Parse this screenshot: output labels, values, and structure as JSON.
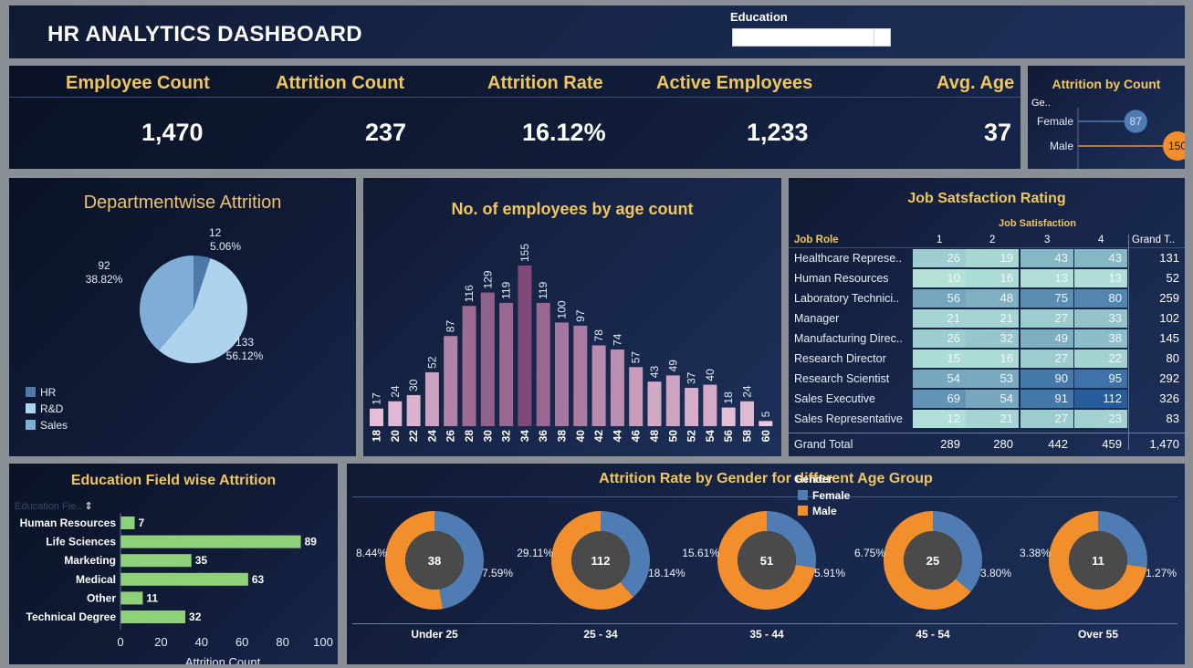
{
  "header": {
    "title": "HR ANALYTICS DASHBOARD",
    "filter_label": "Education",
    "filter_value": ""
  },
  "kpis": [
    {
      "label": "Employee Count",
      "value": "1,470"
    },
    {
      "label": "Attrition Count",
      "value": "237"
    },
    {
      "label": "Attrition Rate",
      "value": "16.12%"
    },
    {
      "label": "Active Employees",
      "value": "1,233"
    },
    {
      "label": "Avg. Age",
      "value": "37"
    }
  ],
  "colors": {
    "gold": "#f0c75e",
    "female": "#4f7db3",
    "male": "#f28e2b",
    "hr": "#4e79a7",
    "rnd": "#aed3ef",
    "sales": "#7eaed8",
    "age_bar_dark": "#7f4a7a",
    "age_bar_light": "#f1cce3",
    "edu_bar": "#8fd07a"
  },
  "chart_data": [
    {
      "id": "attrition_by_count",
      "type": "scatter",
      "title": "Attrition by Count",
      "column_header": "Ge..",
      "categories": [
        "Female",
        "Male"
      ],
      "values": [
        87,
        150
      ]
    },
    {
      "id": "department_attrition",
      "type": "pie",
      "title": "Departmentwise Attrition",
      "categories": [
        "HR",
        "R&D",
        "Sales"
      ],
      "values": [
        12,
        133,
        92
      ],
      "labels": [
        "5.06%",
        "56.12%",
        "38.82%"
      ]
    },
    {
      "id": "age_count",
      "type": "bar",
      "title": "No. of employees by age count",
      "categories": [
        "18",
        "20",
        "22",
        "24",
        "26",
        "28",
        "30",
        "32",
        "34",
        "36",
        "38",
        "40",
        "42",
        "44",
        "46",
        "48",
        "50",
        "52",
        "54",
        "56",
        "58",
        "60"
      ],
      "values": [
        17,
        24,
        30,
        52,
        87,
        116,
        129,
        119,
        155,
        119,
        100,
        97,
        78,
        74,
        57,
        43,
        49,
        37,
        40,
        18,
        24,
        5
      ]
    },
    {
      "id": "job_satisfaction",
      "type": "heatmap",
      "title": "Job Satsfaction Rating",
      "column_group": "Job Satisfaction",
      "row_header": "Job Role",
      "columns": [
        "1",
        "2",
        "3",
        "4"
      ],
      "total_header": "Grand T..",
      "rows": [
        {
          "role": "Healthcare Represe..",
          "values": [
            26,
            19,
            43,
            43
          ],
          "total": 131
        },
        {
          "role": "Human Resources",
          "values": [
            10,
            16,
            13,
            13
          ],
          "total": 52
        },
        {
          "role": "Laboratory Technici..",
          "values": [
            56,
            48,
            75,
            80
          ],
          "total": 259
        },
        {
          "role": "Manager",
          "values": [
            21,
            21,
            27,
            33
          ],
          "total": 102
        },
        {
          "role": "Manufacturing Direc..",
          "values": [
            26,
            32,
            49,
            38
          ],
          "total": 145
        },
        {
          "role": "Research Director",
          "values": [
            15,
            16,
            27,
            22
          ],
          "total": 80
        },
        {
          "role": "Research Scientist",
          "values": [
            54,
            53,
            90,
            95
          ],
          "total": 292
        },
        {
          "role": "Sales Executive",
          "values": [
            69,
            54,
            91,
            112
          ],
          "total": 326
        },
        {
          "role": "Sales Representative",
          "values": [
            12,
            21,
            27,
            23
          ],
          "total": 83
        }
      ],
      "grand_total": {
        "label": "Grand Total",
        "values": [
          "289",
          "280",
          "442",
          "459"
        ],
        "total": "1,470"
      }
    },
    {
      "id": "education_field",
      "type": "bar",
      "orientation": "horizontal",
      "title": "Education Field wise Attrition",
      "field_header": "Education Fie..",
      "categories": [
        "Human Resources",
        "Life Sciences",
        "Marketing",
        "Medical",
        "Other",
        "Technical Degree"
      ],
      "values": [
        7,
        89,
        35,
        63,
        11,
        32
      ],
      "xlim": [
        0,
        100
      ],
      "xticks": [
        "0",
        "20",
        "40",
        "60",
        "80",
        "100"
      ],
      "xlabel": "Attrition Count"
    },
    {
      "id": "gender_age_group",
      "type": "pie",
      "title": "Attrition Rate by Gender for different Age Group",
      "legend_title": "Gender",
      "legend": [
        "Female",
        "Male"
      ],
      "groups": [
        {
          "label": "Under 25",
          "total": "38",
          "female_pct": "7.59%",
          "male_pct": "8.44%",
          "female": 7.59,
          "male": 8.44
        },
        {
          "label": "25 - 34",
          "total": "112",
          "female_pct": "18.14%",
          "male_pct": "29.11%",
          "female": 18.14,
          "male": 29.11
        },
        {
          "label": "35 - 44",
          "total": "51",
          "female_pct": "5.91%",
          "male_pct": "15.61%",
          "female": 5.91,
          "male": 15.61
        },
        {
          "label": "45 - 54",
          "total": "25",
          "female_pct": "3.80%",
          "male_pct": "6.75%",
          "female": 3.8,
          "male": 6.75
        },
        {
          "label": "Over 55",
          "total": "11",
          "female_pct": "1.27%",
          "male_pct": "3.38%",
          "female": 1.27,
          "male": 3.38
        }
      ]
    }
  ]
}
